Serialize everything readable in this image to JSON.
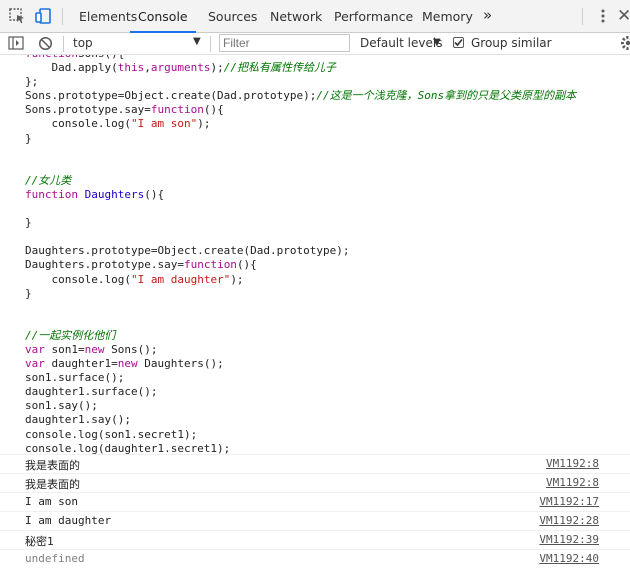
{
  "tabs": [
    {
      "label": "Elements"
    },
    {
      "label": "Console",
      "active": true
    },
    {
      "label": "Sources"
    },
    {
      "label": "Network"
    },
    {
      "label": "Performance"
    },
    {
      "label": "Memory"
    }
  ],
  "more_tabs_symbol": "»",
  "toolbar": {
    "context": "top",
    "filter_placeholder": "Filter",
    "levels_label": "Default levels",
    "group_similar_label": "Group similar",
    "group_similar_checked": true
  },
  "code_lines": [
    {
      "segs": [
        [
          "kw",
          "function"
        ],
        [
          "",
          "Sons"
        ],
        [
          "",
          "(){"
        ]
      ]
    },
    {
      "segs": [
        [
          "",
          "    Dad.apply("
        ],
        [
          "kw",
          "this"
        ],
        [
          "",
          ","
        ],
        [
          "kw",
          "arguments"
        ],
        [
          "",
          ");"
        ],
        [
          "cm",
          "//把私有属性传给儿子"
        ]
      ]
    },
    {
      "segs": [
        [
          "",
          "};"
        ]
      ]
    },
    {
      "segs": [
        [
          "",
          "Sons.prototype=Object.create(Dad.prototype);"
        ],
        [
          "cm",
          "//这是一个浅克隆，Sons拿到的只是父类原型的副本"
        ]
      ]
    },
    {
      "segs": [
        [
          "",
          "Sons.prototype.say="
        ],
        [
          "kw",
          "function"
        ],
        [
          "",
          "(){"
        ]
      ]
    },
    {
      "segs": [
        [
          "",
          "    console.log("
        ],
        [
          "str",
          "\"I am son\""
        ],
        [
          "",
          ");"
        ]
      ]
    },
    {
      "segs": [
        [
          "",
          "}"
        ]
      ]
    },
    {
      "segs": []
    },
    {
      "segs": []
    },
    {
      "segs": [
        [
          "cm",
          "//女儿类"
        ]
      ]
    },
    {
      "segs": [
        [
          "kw",
          "function"
        ],
        [
          "fn",
          " Daughters"
        ],
        [
          "",
          "(){"
        ]
      ]
    },
    {
      "segs": []
    },
    {
      "segs": [
        [
          "",
          "}"
        ]
      ]
    },
    {
      "segs": []
    },
    {
      "segs": [
        [
          "",
          "Daughters.prototype=Object.create(Dad.prototype);"
        ]
      ]
    },
    {
      "segs": [
        [
          "",
          "Daughters.prototype.say="
        ],
        [
          "kw",
          "function"
        ],
        [
          "",
          "(){"
        ]
      ]
    },
    {
      "segs": [
        [
          "",
          "    console.log("
        ],
        [
          "str",
          "\"I am daughter\""
        ],
        [
          "",
          ");"
        ]
      ]
    },
    {
      "segs": [
        [
          "",
          "}"
        ]
      ]
    },
    {
      "segs": []
    },
    {
      "segs": []
    },
    {
      "segs": [
        [
          "cm",
          "//一起实例化他们"
        ]
      ]
    },
    {
      "segs": [
        [
          "kw",
          "var"
        ],
        [
          "",
          " son1="
        ],
        [
          "kw",
          "new"
        ],
        [
          "",
          " Sons();"
        ]
      ]
    },
    {
      "segs": [
        [
          "kw",
          "var"
        ],
        [
          "",
          " daughter1="
        ],
        [
          "kw",
          "new"
        ],
        [
          "",
          " Daughters();"
        ]
      ]
    },
    {
      "segs": [
        [
          "",
          "son1.surface();"
        ]
      ]
    },
    {
      "segs": [
        [
          "",
          "daughter1.surface();"
        ]
      ]
    },
    {
      "segs": [
        [
          "",
          "son1.say();"
        ]
      ]
    },
    {
      "segs": [
        [
          "",
          "daughter1.say();"
        ]
      ]
    },
    {
      "segs": [
        [
          "",
          "console.log(son1.secret1);"
        ]
      ]
    },
    {
      "segs": [
        [
          "",
          "console.log(daughter1.secret1);"
        ]
      ]
    }
  ],
  "outputs": [
    {
      "text": "我是表面的",
      "source": "VM1192:8",
      "muted": false
    },
    {
      "text": "我是表面的",
      "source": "VM1192:8",
      "muted": false
    },
    {
      "text": "I am son",
      "source": "VM1192:17",
      "muted": false
    },
    {
      "text": "I am daughter",
      "source": "VM1192:28",
      "muted": false
    },
    {
      "text": "秘密1",
      "source": "VM1192:39",
      "muted": false
    },
    {
      "text": "undefined",
      "source": "VM1192:40",
      "muted": true
    }
  ]
}
